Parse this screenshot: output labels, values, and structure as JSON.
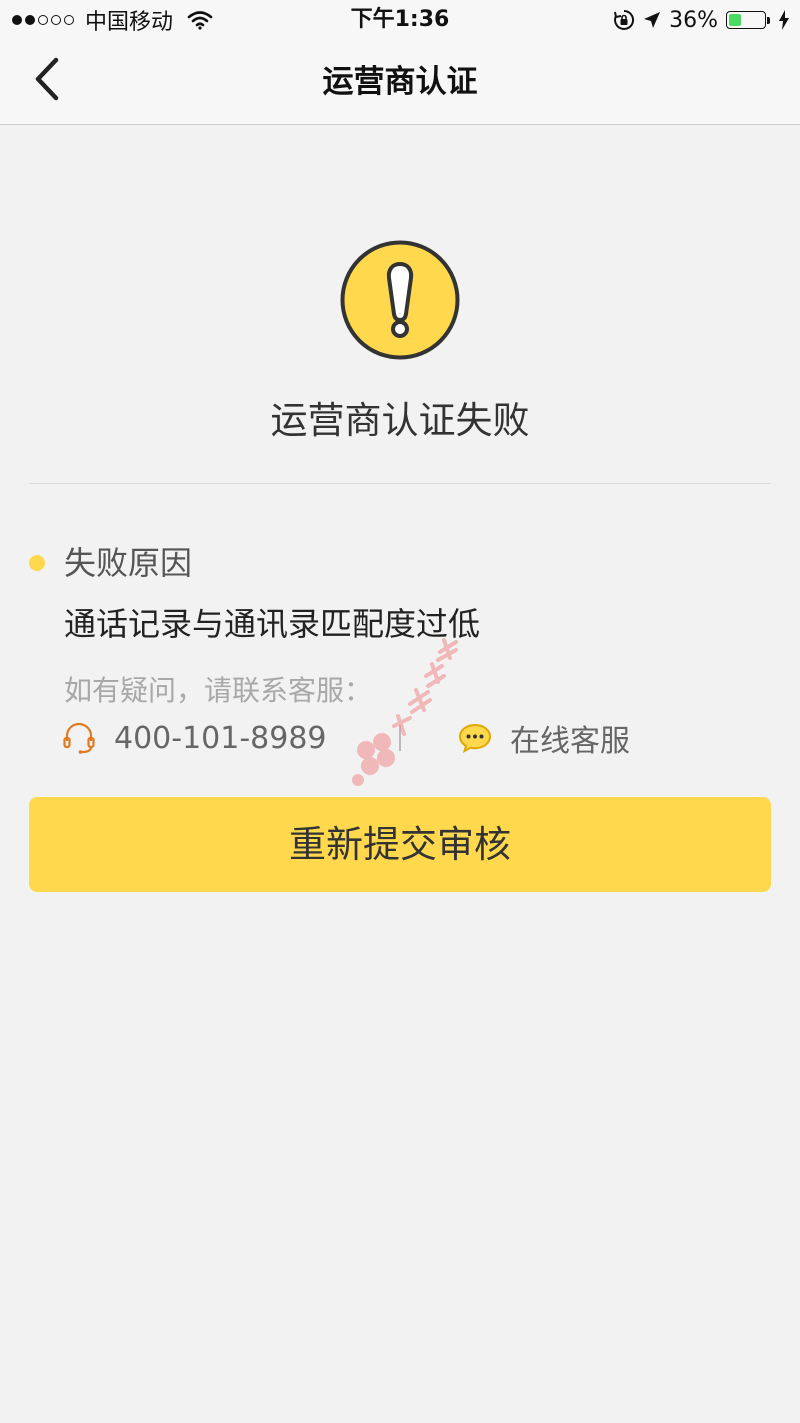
{
  "status_bar": {
    "carrier": "中国移动",
    "time": "下午1:36",
    "battery_percent": "36%",
    "battery_level": 0.36,
    "signal_bars_filled": 2,
    "signal_bars_total": 5,
    "icons": [
      "wifi-icon",
      "orientation-lock-icon",
      "location-arrow-icon",
      "battery-icon",
      "charging-icon"
    ]
  },
  "nav": {
    "title": "运营商认证",
    "back_icon": "chevron-left-icon"
  },
  "result": {
    "icon": "warning-exclamation-icon",
    "title": "运营商认证失败"
  },
  "reason": {
    "label": "失败原因",
    "text": "通话记录与通讯录匹配度过低"
  },
  "contact": {
    "hint": "如有疑问，请联系客服：",
    "phone_icon": "headset-icon",
    "phone": "400-101-8989",
    "online_icon": "chat-bubble-icon",
    "online_label": "在线客服"
  },
  "actions": {
    "resubmit_label": "重新提交审核"
  },
  "colors": {
    "accent": "#ffd84d",
    "background": "#f2f2f2",
    "battery": "#4cd964"
  }
}
